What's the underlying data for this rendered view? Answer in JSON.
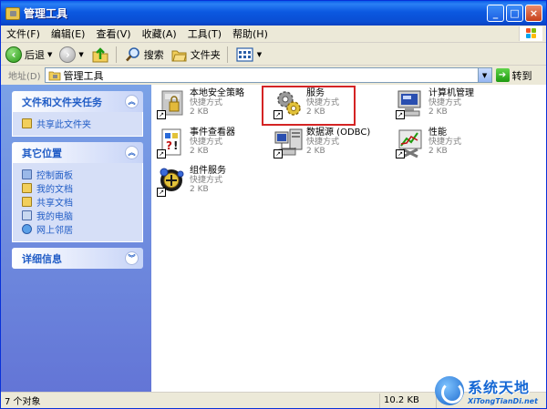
{
  "window": {
    "title": "管理工具",
    "buttons": {
      "minimize": "_",
      "maximize": "□",
      "close": "×"
    }
  },
  "menubar": {
    "items": [
      "文件(F)",
      "编辑(E)",
      "查看(V)",
      "收藏(A)",
      "工具(T)",
      "帮助(H)"
    ]
  },
  "toolbar": {
    "back": "后退",
    "search": "搜索",
    "folders": "文件夹"
  },
  "address": {
    "label": "地址(D)",
    "value": "管理工具",
    "go": "转到"
  },
  "sidebar": {
    "panels": [
      {
        "title": "文件和文件夹任务",
        "links": [
          "共享此文件夹"
        ]
      },
      {
        "title": "其它位置",
        "links": [
          "控制面板",
          "我的文档",
          "共享文档",
          "我的电脑",
          "网上邻居"
        ]
      },
      {
        "title": "详细信息",
        "links": []
      }
    ]
  },
  "files": [
    {
      "name": "本地安全策略",
      "type": "快捷方式",
      "size": "2 KB"
    },
    {
      "name": "服务",
      "type": "快捷方式",
      "size": "2 KB"
    },
    {
      "name": "计算机管理",
      "type": "快捷方式",
      "size": "2 KB"
    },
    {
      "name": "事件查看器",
      "type": "快捷方式",
      "size": "2 KB"
    },
    {
      "name": "数据源 (ODBC)",
      "type": "快捷方式",
      "size": "2 KB"
    },
    {
      "name": "性能",
      "type": "快捷方式",
      "size": "2 KB"
    },
    {
      "name": "组件服务",
      "type": "快捷方式",
      "size": "2 KB"
    }
  ],
  "statusbar": {
    "count": "7 个对象",
    "size": "10.2 KB"
  },
  "watermark": {
    "cn": "系统天地",
    "en": "XiTongTianDi.net"
  },
  "colors": {
    "titlebar": "#0a4ed3",
    "sidebar": "#6375d6",
    "highlight": "#d42424",
    "link": "#215dc6"
  }
}
